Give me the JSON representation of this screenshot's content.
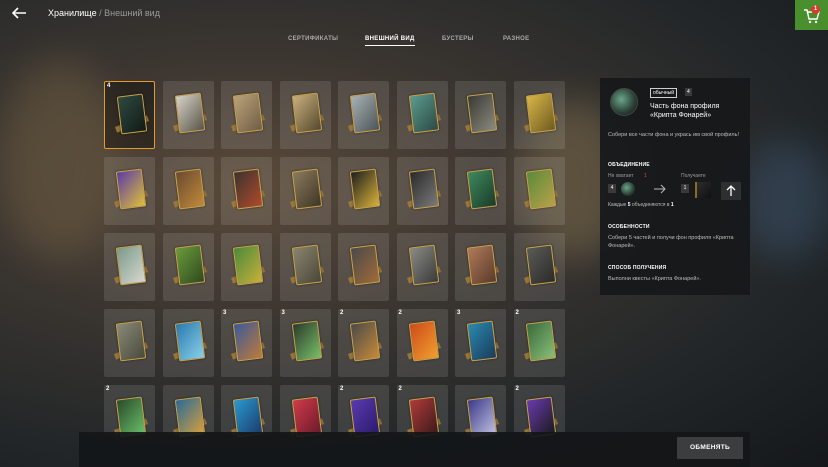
{
  "header": {
    "breadcrumb_root": "Хранилище",
    "breadcrumb_current": "Внешний вид",
    "separator": "/",
    "cart_badge": "1"
  },
  "tabs": [
    {
      "label": "СЕРТИФИКАТЫ",
      "active": false
    },
    {
      "label": "ВНЕШНИЙ ВИД",
      "active": true
    },
    {
      "label": "БУСТЕРЫ",
      "active": false
    },
    {
      "label": "РАЗНОЕ",
      "active": false
    }
  ],
  "grid": {
    "rows": [
      [
        {
          "count": "4",
          "selected": true,
          "colors": [
            "#2e4a40",
            "#121a18"
          ]
        },
        {
          "count": "",
          "colors": [
            "#d7d3c8",
            "#5a5548"
          ]
        },
        {
          "count": "",
          "colors": [
            "#bba27a",
            "#6f5d45"
          ]
        },
        {
          "count": "",
          "colors": [
            "#c9b07c",
            "#55482f"
          ]
        },
        {
          "count": "",
          "colors": [
            "#a9b3b6",
            "#4b5456"
          ]
        },
        {
          "count": "",
          "colors": [
            "#5c9b8e",
            "#2c4a44"
          ]
        },
        {
          "count": "",
          "colors": [
            "#3a3a36",
            "#8b8b7f"
          ]
        },
        {
          "count": "",
          "colors": [
            "#d9b648",
            "#6e5a1f"
          ]
        }
      ],
      [
        {
          "count": "",
          "colors": [
            "#5b3aa8",
            "#e0c13a"
          ]
        },
        {
          "count": "",
          "colors": [
            "#6b4a2f",
            "#c08a3a"
          ]
        },
        {
          "count": "",
          "colors": [
            "#3b3330",
            "#b04a2c"
          ]
        },
        {
          "count": "",
          "colors": [
            "#8a7b5c",
            "#3f3526"
          ]
        },
        {
          "count": "",
          "colors": [
            "#1e1e1e",
            "#d9b23a"
          ]
        },
        {
          "count": "",
          "colors": [
            "#2a2a2a",
            "#7a7a7a"
          ]
        },
        {
          "count": "",
          "colors": [
            "#3d8a5c",
            "#1b3a2a"
          ]
        },
        {
          "count": "",
          "colors": [
            "#5b8a3a",
            "#b8a24a"
          ]
        }
      ],
      [
        {
          "count": "",
          "colors": [
            "#7a9a8a",
            "#d8d8d0"
          ]
        },
        {
          "count": "",
          "colors": [
            "#6a9a3a",
            "#2f4a1f"
          ]
        },
        {
          "count": "",
          "colors": [
            "#4a8a3a",
            "#c8b03a"
          ]
        },
        {
          "count": "",
          "colors": [
            "#8a8570",
            "#4a4638"
          ]
        },
        {
          "count": "",
          "colors": [
            "#4a4a4a",
            "#a06a3a"
          ]
        },
        {
          "count": "",
          "colors": [
            "#8a8a86",
            "#3a3a38"
          ]
        },
        {
          "count": "",
          "colors": [
            "#b07a5a",
            "#5a3a2a"
          ]
        },
        {
          "count": "",
          "colors": [
            "#5a5a58",
            "#2a2a28"
          ]
        }
      ],
      [
        {
          "count": "",
          "colors": [
            "#8a8a7a",
            "#4a4a3a"
          ]
        },
        {
          "count": "",
          "colors": [
            "#2a7ab0",
            "#8ad0e8"
          ]
        },
        {
          "count": "3",
          "colors": [
            "#3a5a9a",
            "#c07a3a"
          ]
        },
        {
          "count": "3",
          "colors": [
            "#2a3a2a",
            "#7ac06a"
          ]
        },
        {
          "count": "2",
          "colors": [
            "#4a4a4a",
            "#c88a3a"
          ]
        },
        {
          "count": "2",
          "colors": [
            "#d04a1a",
            "#f0a030"
          ]
        },
        {
          "count": "3",
          "colors": [
            "#2a8ab0",
            "#1a3a5a"
          ]
        },
        {
          "count": "2",
          "colors": [
            "#3a6a3a",
            "#8ac07a"
          ]
        }
      ],
      [
        {
          "count": "2",
          "colors": [
            "#2a4a2a",
            "#6ac06a"
          ]
        },
        {
          "count": "",
          "colors": [
            "#2a6a9a",
            "#d8a03a"
          ]
        },
        {
          "count": "",
          "colors": [
            "#2a9ad0",
            "#1a3a6a"
          ]
        },
        {
          "count": "",
          "colors": [
            "#d03a4a",
            "#6a1a2a"
          ]
        },
        {
          "count": "2",
          "colors": [
            "#5a3ab0",
            "#2a1a6a"
          ]
        },
        {
          "count": "2",
          "colors": [
            "#b03a3a",
            "#3a1a1a"
          ]
        },
        {
          "count": "",
          "colors": [
            "#3a3a8a",
            "#c0c0e0"
          ]
        },
        {
          "count": "2",
          "colors": [
            "#6a3ab0",
            "#1a1a1a"
          ]
        }
      ]
    ]
  },
  "detail": {
    "rarity": "обычный",
    "count": "4",
    "title": "Часть фона профиля «Крипта Фонарей»",
    "description": "Собери все части фона и укрась им свой профиль!",
    "merge_heading": "ОБЪЕДИНЕНИЕ",
    "missing_label": "Не хватает",
    "missing_value": "1",
    "receive_label": "Получаете",
    "have_count": "4",
    "receive_count": "1",
    "ratio_prefix": "Каждые",
    "ratio_from": "5",
    "ratio_middle": "объединяются в",
    "ratio_to": "1",
    "features_heading": "ОСОБЕННОСТИ",
    "features_text": "Собери 5 частей и получи фон профиля «Крипта Фонарей».",
    "obtain_heading": "СПОСОБ ПОЛУЧЕНИЯ",
    "obtain_text": "Выполни квесты «Крипта Фонарей»."
  },
  "footer": {
    "exchange_label": "ОБМЕНЯТЬ"
  }
}
